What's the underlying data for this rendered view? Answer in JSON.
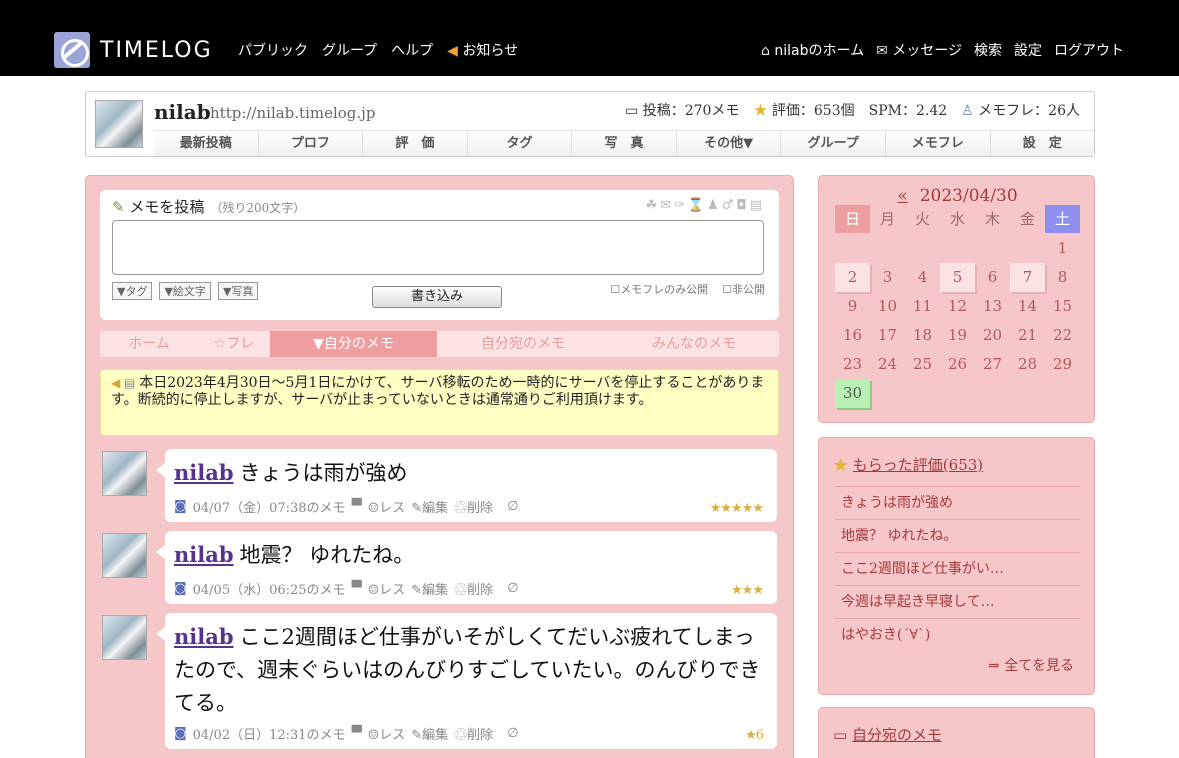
{
  "header": {
    "logo_text": "TIMELOG",
    "nav_left": [
      "パブリック",
      "グループ",
      "ヘルプ",
      "お知らせ"
    ],
    "nav_right": [
      "nilabのホーム",
      "メッセージ",
      "検索",
      "設定",
      "ログアウト"
    ]
  },
  "profile": {
    "name": "nilab",
    "url": "http://nilab.timelog.jp",
    "stats": {
      "posts": "投稿：270メモ",
      "rating": "評価：653個",
      "spm": "SPM：2.42",
      "memofure": "メモフレ：26人"
    },
    "tabs": [
      "最新投稿",
      "プロフ",
      "評　価",
      "タグ",
      "写　真",
      "その他▼",
      "グループ",
      "メモフレ",
      "設　定"
    ]
  },
  "post_form": {
    "title": "メモを投稿",
    "remaining": "（残り200文字）",
    "options": [
      "▼タグ",
      "▼絵文字",
      "▼写真"
    ],
    "submit_label": "書き込み",
    "check_friends": "メモフレのみ公開",
    "check_private": "非公開"
  },
  "memo_tabs": [
    "ホーム",
    "☆フレ",
    "▼自分のメモ",
    "自分宛のメモ",
    "みんなのメモ"
  ],
  "notice": "本日2023年4月30日〜5月1日にかけて、サーバ移転のため一時的にサーバを停止することがあります。断続的に停止しますが、サーバが止まっていないときは通常通りご利用頂けます。",
  "entries": [
    {
      "user": "nilab",
      "text": "きょうは雨が強め",
      "date": "04/07（金）07:38のメモ",
      "reply": "レス",
      "edit": "編集",
      "delete": "削除",
      "stars": "★★★★★"
    },
    {
      "user": "nilab",
      "text": "地震？ ゆれたね。",
      "date": "04/05（水）06:25のメモ",
      "reply": "レス",
      "edit": "編集",
      "delete": "削除",
      "stars": "★★★"
    },
    {
      "user": "nilab",
      "text": "ここ2週間ほど仕事がいそがしくてだいぶ疲れてしまったので、週末ぐらいはのんびりすごしていたい。のんびりできてる。",
      "date": "04/02（日）12:31のメモ",
      "reply": "レス",
      "edit": "編集",
      "delete": "削除",
      "stars": "★6"
    }
  ],
  "calendar": {
    "prev": "«",
    "month": "2023/04/30",
    "weekdays": [
      "日",
      "月",
      "火",
      "水",
      "木",
      "金",
      "土"
    ],
    "days": [
      "",
      "",
      "",
      "",
      "",
      "",
      "1",
      "2",
      "3",
      "4",
      "5",
      "6",
      "7",
      "8",
      "9",
      "10",
      "11",
      "12",
      "13",
      "14",
      "15",
      "16",
      "17",
      "18",
      "19",
      "20",
      "21",
      "22",
      "23",
      "24",
      "25",
      "26",
      "27",
      "28",
      "29",
      "30"
    ],
    "highlighted": [
      "2",
      "5",
      "7"
    ],
    "today": "30"
  },
  "ratings": {
    "title": "もらった評価(653)",
    "items": [
      "きょうは雨が強め",
      "地震？ ゆれたね。",
      "ここ2週間ほど仕事がい…",
      "今週は早起き早寝して…",
      "はやおき(´∀`)"
    ],
    "more": "⇒ 全てを見る"
  },
  "to_me": {
    "title": "自分宛のメモ"
  }
}
